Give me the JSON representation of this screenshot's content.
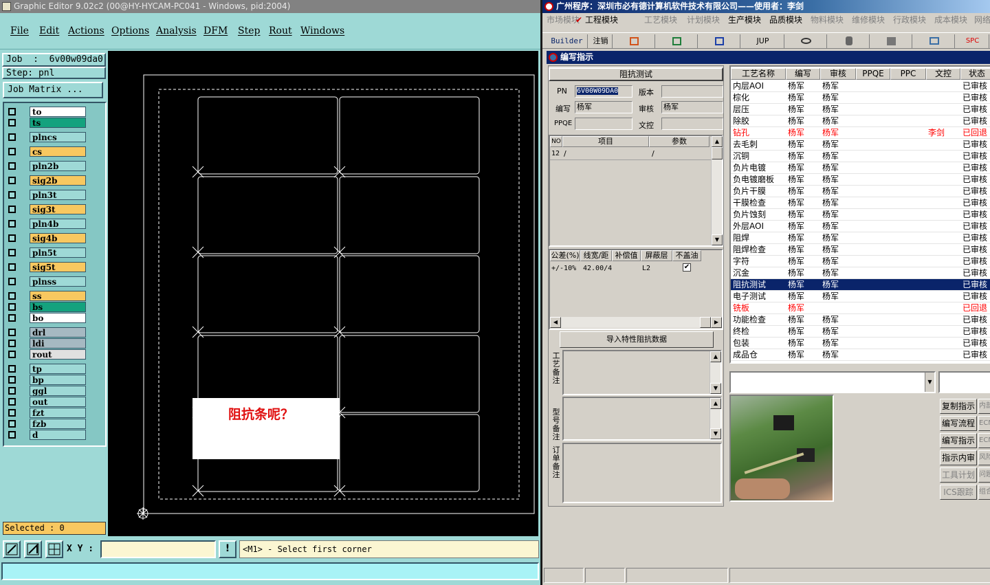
{
  "graphic_editor": {
    "title": "Graphic Editor 9.02c2 (00@HY-HYCAM-PC041 - Windows, pid:2004)",
    "menu": [
      "File",
      "Edit",
      "Actions",
      "Options",
      "Analysis",
      "DFM",
      "Step",
      "Rout",
      "Windows"
    ],
    "job": "Job  :  6v00w09da0",
    "step": "Step: pnl",
    "job_matrix": "Job Matrix ...",
    "layers": [
      {
        "name": "to",
        "color": "#ffffff"
      },
      {
        "name": "ts",
        "color": "#14a27e"
      },
      {
        "name": "plncs",
        "color": "#9ed9d6"
      },
      {
        "name": "cs",
        "color": "#f8c860"
      },
      {
        "name": "pln2b",
        "color": "#9ed9d6"
      },
      {
        "name": "sig2b",
        "color": "#f8c860"
      },
      {
        "name": "pln3t",
        "color": "#9ed9d6"
      },
      {
        "name": "sig3t",
        "color": "#f8c860"
      },
      {
        "name": "pln4b",
        "color": "#9ed9d6"
      },
      {
        "name": "sig4b",
        "color": "#f8c860"
      },
      {
        "name": "pln5t",
        "color": "#9ed9d6"
      },
      {
        "name": "sig5t",
        "color": "#f8c860"
      },
      {
        "name": "plnss",
        "color": "#9ed9d6"
      },
      {
        "name": "ss",
        "color": "#f8c860"
      },
      {
        "name": "bs",
        "color": "#14a27e"
      },
      {
        "name": "bo",
        "color": "#ffffff"
      },
      {
        "name": "drl",
        "color": "#a6b9c2"
      },
      {
        "name": "ldi",
        "color": "#a6b9c2"
      },
      {
        "name": "rout",
        "color": "#e0e0e0"
      },
      {
        "name": "tp",
        "color": "#9ed9d6"
      },
      {
        "name": "bp",
        "color": "#9ed9d6"
      },
      {
        "name": "ggl",
        "color": "#9ed9d6"
      },
      {
        "name": "out",
        "color": "#9ed9d6"
      },
      {
        "name": "fzt",
        "color": "#9ed9d6"
      },
      {
        "name": "fzb",
        "color": "#9ed9d6"
      },
      {
        "name": "d",
        "color": "#9ed9d6"
      }
    ],
    "selected": "Selected : 0",
    "xy_label": "X Y :",
    "xy_value": "",
    "bang": "!",
    "prompt": "<M1> - Select first corner",
    "annotation": "阻抗条呢？"
  },
  "process_app": {
    "title": "广州程序：深圳市必有德计算机软件技术有限公司——使用者：李剑",
    "modules": [
      {
        "label": "市场模块",
        "active": false
      },
      {
        "label": "工程模块",
        "active": true
      },
      {
        "label": "工艺模块",
        "active": false
      },
      {
        "label": "计划模块",
        "active": false
      },
      {
        "label": "生产模块",
        "active": true
      },
      {
        "label": "品质模块",
        "active": true
      },
      {
        "label": "物料模块",
        "active": false
      },
      {
        "label": "维修模块",
        "active": false
      },
      {
        "label": "行政模块",
        "active": false
      },
      {
        "label": "成本模块",
        "active": false
      },
      {
        "label": "网络",
        "active": false
      }
    ],
    "toolbar": {
      "builder": "Builder",
      "logout": "注销",
      "jup": "JUP",
      "spc": "SPC"
    },
    "window_title": "编写指示",
    "form": {
      "heading": "阻抗测试",
      "pn_label": "PN",
      "pn_value": "6V00W09DA0",
      "version_label": "版本",
      "version_value": "",
      "author_label": "编写",
      "author_value": "杨军",
      "review_label": "审核",
      "review_value": "杨军",
      "ppqe_label": "PPQE",
      "ppqe_value": "",
      "control_label": "文控",
      "control_value": ""
    },
    "items_grid": {
      "headers": [
        "NO",
        "项目",
        "参数"
      ],
      "rows": [
        [
          "12",
          "/",
          "/"
        ]
      ]
    },
    "impedance_grid": {
      "headers": [
        "公差(%)",
        "线宽/距",
        "补偿值",
        "屏蔽层",
        "不盖油"
      ],
      "rows": [
        [
          "+/-10%",
          "42.00/4",
          "",
          "L2",
          "✔"
        ]
      ]
    },
    "import_button": "导入特性阻抗数据",
    "remark_labels": [
      "工艺备注",
      "型号备注",
      "订单备注"
    ],
    "process_table": {
      "headers": [
        "工艺名称",
        "编写",
        "审核",
        "PPQE",
        "PPC",
        "文控",
        "状态"
      ],
      "rows": [
        {
          "name": "内层AOI",
          "author": "杨军",
          "review": "杨军",
          "ppqe": "",
          "ppc": "",
          "control": "",
          "status": "已审核",
          "state": "normal"
        },
        {
          "name": "棕化",
          "author": "杨军",
          "review": "杨军",
          "ppqe": "",
          "ppc": "",
          "control": "",
          "status": "已审核",
          "state": "normal"
        },
        {
          "name": "层压",
          "author": "杨军",
          "review": "杨军",
          "ppqe": "",
          "ppc": "",
          "control": "",
          "status": "已审核",
          "state": "normal"
        },
        {
          "name": "除胶",
          "author": "杨军",
          "review": "杨军",
          "ppqe": "",
          "ppc": "",
          "control": "",
          "status": "已审核",
          "state": "normal"
        },
        {
          "name": "钻孔",
          "author": "杨军",
          "review": "杨军",
          "ppqe": "",
          "ppc": "",
          "control": "李剑",
          "status": "已回退",
          "state": "returned"
        },
        {
          "name": "去毛刺",
          "author": "杨军",
          "review": "杨军",
          "ppqe": "",
          "ppc": "",
          "control": "",
          "status": "已审核",
          "state": "normal"
        },
        {
          "name": "沉铜",
          "author": "杨军",
          "review": "杨军",
          "ppqe": "",
          "ppc": "",
          "control": "",
          "status": "已审核",
          "state": "normal"
        },
        {
          "name": "负片电镀",
          "author": "杨军",
          "review": "杨军",
          "ppqe": "",
          "ppc": "",
          "control": "",
          "status": "已审核",
          "state": "normal"
        },
        {
          "name": "负电镀磨板",
          "author": "杨军",
          "review": "杨军",
          "ppqe": "",
          "ppc": "",
          "control": "",
          "status": "已审核",
          "state": "normal"
        },
        {
          "name": "负片干膜",
          "author": "杨军",
          "review": "杨军",
          "ppqe": "",
          "ppc": "",
          "control": "",
          "status": "已审核",
          "state": "normal"
        },
        {
          "name": "干膜检查",
          "author": "杨军",
          "review": "杨军",
          "ppqe": "",
          "ppc": "",
          "control": "",
          "status": "已审核",
          "state": "normal"
        },
        {
          "name": "负片蚀刻",
          "author": "杨军",
          "review": "杨军",
          "ppqe": "",
          "ppc": "",
          "control": "",
          "status": "已审核",
          "state": "normal"
        },
        {
          "name": "外层AOI",
          "author": "杨军",
          "review": "杨军",
          "ppqe": "",
          "ppc": "",
          "control": "",
          "status": "已审核",
          "state": "normal"
        },
        {
          "name": "阻焊",
          "author": "杨军",
          "review": "杨军",
          "ppqe": "",
          "ppc": "",
          "control": "",
          "status": "已审核",
          "state": "normal"
        },
        {
          "name": "阻焊检查",
          "author": "杨军",
          "review": "杨军",
          "ppqe": "",
          "ppc": "",
          "control": "",
          "status": "已审核",
          "state": "normal"
        },
        {
          "name": "字符",
          "author": "杨军",
          "review": "杨军",
          "ppqe": "",
          "ppc": "",
          "control": "",
          "status": "已审核",
          "state": "normal"
        },
        {
          "name": "沉金",
          "author": "杨军",
          "review": "杨军",
          "ppqe": "",
          "ppc": "",
          "control": "",
          "status": "已审核",
          "state": "normal"
        },
        {
          "name": "阻抗测试",
          "author": "杨军",
          "review": "杨军",
          "ppqe": "",
          "ppc": "",
          "control": "",
          "status": "已审核",
          "state": "selected"
        },
        {
          "name": "电子测试",
          "author": "杨军",
          "review": "杨军",
          "ppqe": "",
          "ppc": "",
          "control": "",
          "status": "已审核",
          "state": "normal"
        },
        {
          "name": "铣板",
          "author": "杨军",
          "review": "",
          "ppqe": "",
          "ppc": "",
          "control": "",
          "status": "已回退",
          "state": "returned"
        },
        {
          "name": "功能检查",
          "author": "杨军",
          "review": "杨军",
          "ppqe": "",
          "ppc": "",
          "control": "",
          "status": "已审核",
          "state": "normal"
        },
        {
          "name": "终检",
          "author": "杨军",
          "review": "杨军",
          "ppqe": "",
          "ppc": "",
          "control": "",
          "status": "已审核",
          "state": "normal"
        },
        {
          "name": "包装",
          "author": "杨军",
          "review": "杨军",
          "ppqe": "",
          "ppc": "",
          "control": "",
          "status": "已审核",
          "state": "normal"
        },
        {
          "name": "成品仓",
          "author": "杨军",
          "review": "杨军",
          "ppqe": "",
          "ppc": "",
          "control": "",
          "status": "已审核",
          "state": "normal"
        }
      ]
    },
    "side_buttons": [
      [
        "复制指示",
        "内部"
      ],
      [
        "编写流程",
        "ECN"
      ],
      [
        "编写指示",
        "ECN"
      ],
      [
        "指示内审",
        "风险"
      ],
      [
        "工具计划",
        "问题"
      ],
      [
        "ICS跟踪",
        "组合"
      ]
    ],
    "colors": {
      "returned": "#ff0000",
      "selected_bg": "#0a246a",
      "accent": "#0a246a"
    }
  }
}
